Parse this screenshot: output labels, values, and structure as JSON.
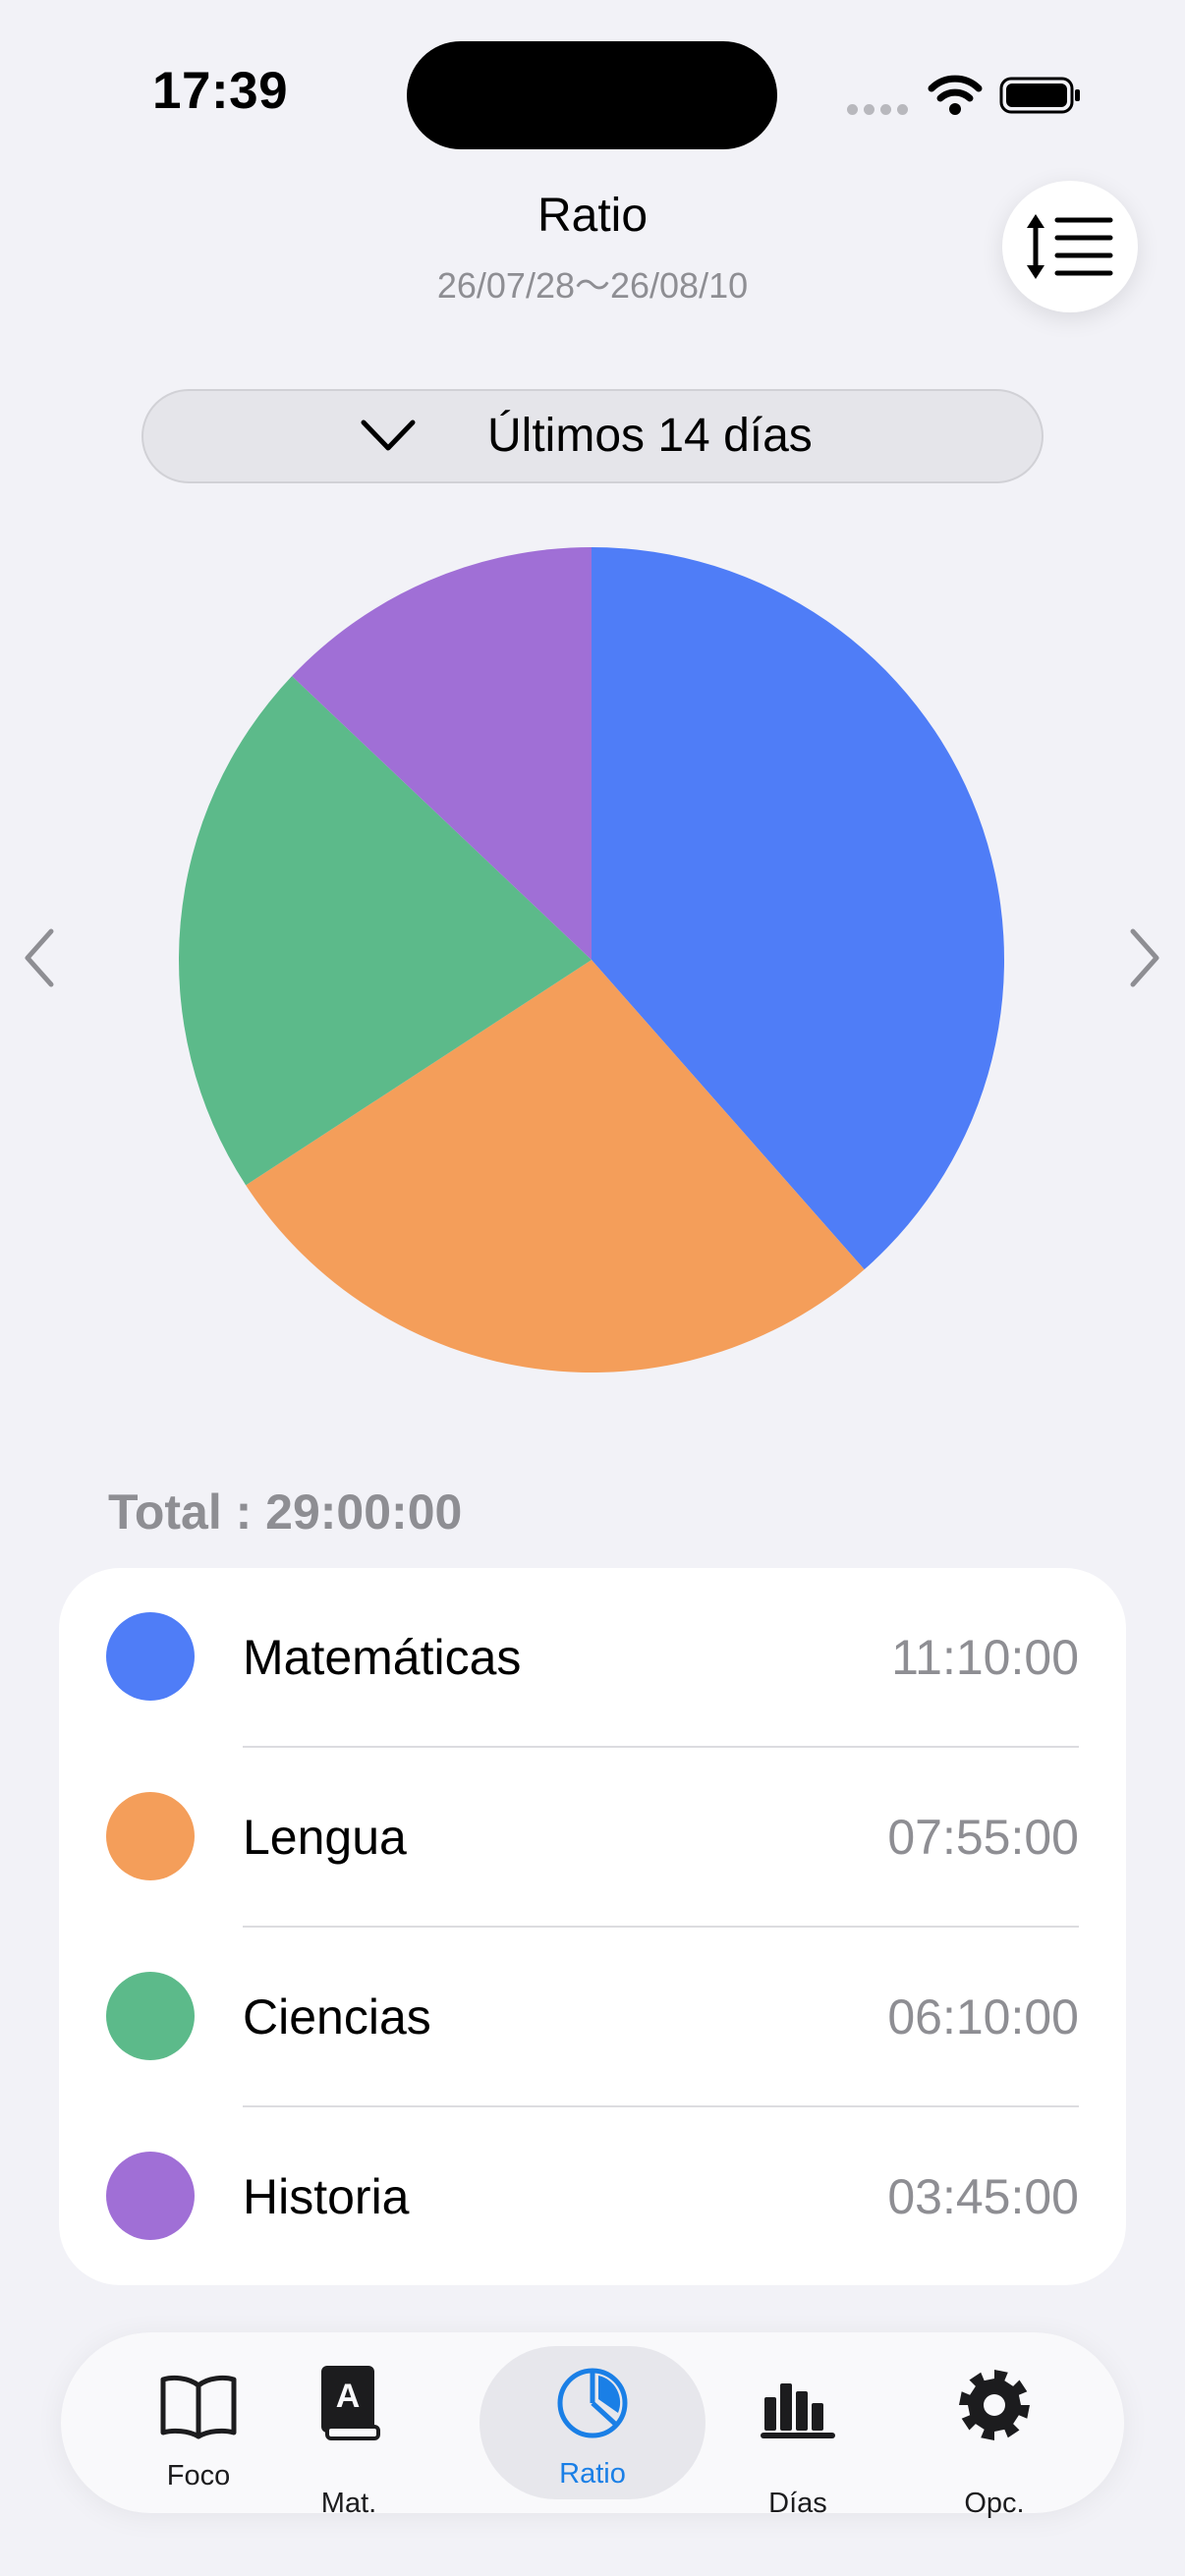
{
  "status_bar": {
    "time": "17:39"
  },
  "header": {
    "title": "Ratio",
    "date_range": "26/07/28〜26/08/10",
    "sort_icon": "sort-lines-icon"
  },
  "range_selector": {
    "label": "Últimos 14 días",
    "icon": "chevron-down-icon"
  },
  "chart_data": {
    "type": "pie",
    "categories": [
      "Matemáticas",
      "Lengua",
      "Ciencias",
      "Historia"
    ],
    "values": [
      11.1667,
      7.9167,
      6.1667,
      3.75
    ],
    "colors": [
      "#4f7df7",
      "#f49e5a",
      "#5cba8a",
      "#a06fd6"
    ]
  },
  "summary": {
    "total": "Total : 29:00:00"
  },
  "legend": [
    {
      "name": "Matemáticas",
      "time": "11:10:00",
      "color": "#4f7df7"
    },
    {
      "name": "Lengua",
      "time": "07:55:00",
      "color": "#f49e5a"
    },
    {
      "name": "Ciencias",
      "time": "06:10:00",
      "color": "#5cba8a"
    },
    {
      "name": "Historia",
      "time": "03:45:00",
      "color": "#a06fd6"
    }
  ],
  "tabs": [
    {
      "label": "Foco",
      "icon": "book-open-icon",
      "active": false
    },
    {
      "label": "Mat.",
      "icon": "book-letter-icon",
      "active": false
    },
    {
      "label": "Ratio",
      "icon": "pie-chart-icon",
      "active": true
    },
    {
      "label": "Días",
      "icon": "bar-chart-icon",
      "active": false
    },
    {
      "label": "Opc.",
      "icon": "gear-icon",
      "active": false
    }
  ],
  "colors": {
    "accent": "#1a7fe6",
    "background": "#f2f2f7",
    "secondary_text": "#8e8e93"
  }
}
